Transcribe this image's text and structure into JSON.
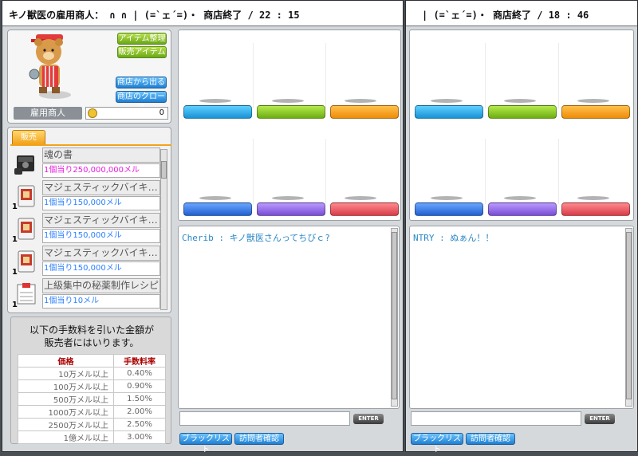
{
  "left_window": {
    "title": "キノ獣医の雇用商人： ∩ ∩  |  (=`ェ´=)・  商店終了 / 22 : 15",
    "buttons": {
      "arrange": "アイテム整理",
      "sell_items": "販売アイテム",
      "leave_shop": "商店から出る",
      "close_shop": "商店のクローズ"
    },
    "merchant_label": "雇用商人",
    "meso": "0",
    "tab_sell": "販売",
    "items": [
      {
        "name": "魂の書",
        "price": "1個当り250,000,000メル",
        "qty": "",
        "icon": "book-icon",
        "price_color": "#e81ae0"
      },
      {
        "name": "マジェスティックバイキ…",
        "price": "1個当り150,000メル",
        "qty": "1",
        "icon": "card-icon",
        "price_color": "#2a7fff"
      },
      {
        "name": "マジェスティックバイキ…",
        "price": "1個当り150,000メル",
        "qty": "1",
        "icon": "card-icon",
        "price_color": "#2a7fff"
      },
      {
        "name": "マジェスティックバイキ…",
        "price": "1個当り150,000メル",
        "qty": "1",
        "icon": "card-icon",
        "price_color": "#2a7fff"
      },
      {
        "name": "上級集中の秘薬制作レシピ",
        "price": "1個当り10メル",
        "qty": "1",
        "icon": "recipe-icon",
        "price_color": "#2a7fff"
      }
    ],
    "fee_notice_line1": "以下の手数料を引いた金額が",
    "fee_notice_line2": "販売者にはいります。",
    "fee_table": {
      "col_price": "価格",
      "col_rate": "手数料率",
      "rows": [
        {
          "price": "10万メル以上",
          "rate": "0.40%"
        },
        {
          "price": "100万メル以上",
          "rate": "0.90%"
        },
        {
          "price": "500万メル以上",
          "rate": "1.50%"
        },
        {
          "price": "1000万メル以上",
          "rate": "2.00%"
        },
        {
          "price": "2500万メル以上",
          "rate": "2.50%"
        },
        {
          "price": "1億メル以上",
          "rate": "3.00%"
        }
      ]
    },
    "chat_message": "Cherib : キノ獣医さんってちびｃ?",
    "enter_label": "ENTER",
    "blacklist": "ブラックリスト",
    "visitor_check": "訪問者確認"
  },
  "right_window": {
    "title": "|  (=`ェ´=)・  商店終了 / 18 : 46",
    "chat_message": "NTRY : ぬぁん！！",
    "enter_label": "ENTER",
    "blacklist": "ブラックリスト",
    "visitor_check": "訪問者確認"
  },
  "slot_colors": {
    "row1": [
      "#1fa0e0",
      "#86c41c",
      "#f29a12"
    ],
    "row2": [
      "#2d6fdc",
      "#8f5fdc",
      "#e0505a"
    ]
  }
}
